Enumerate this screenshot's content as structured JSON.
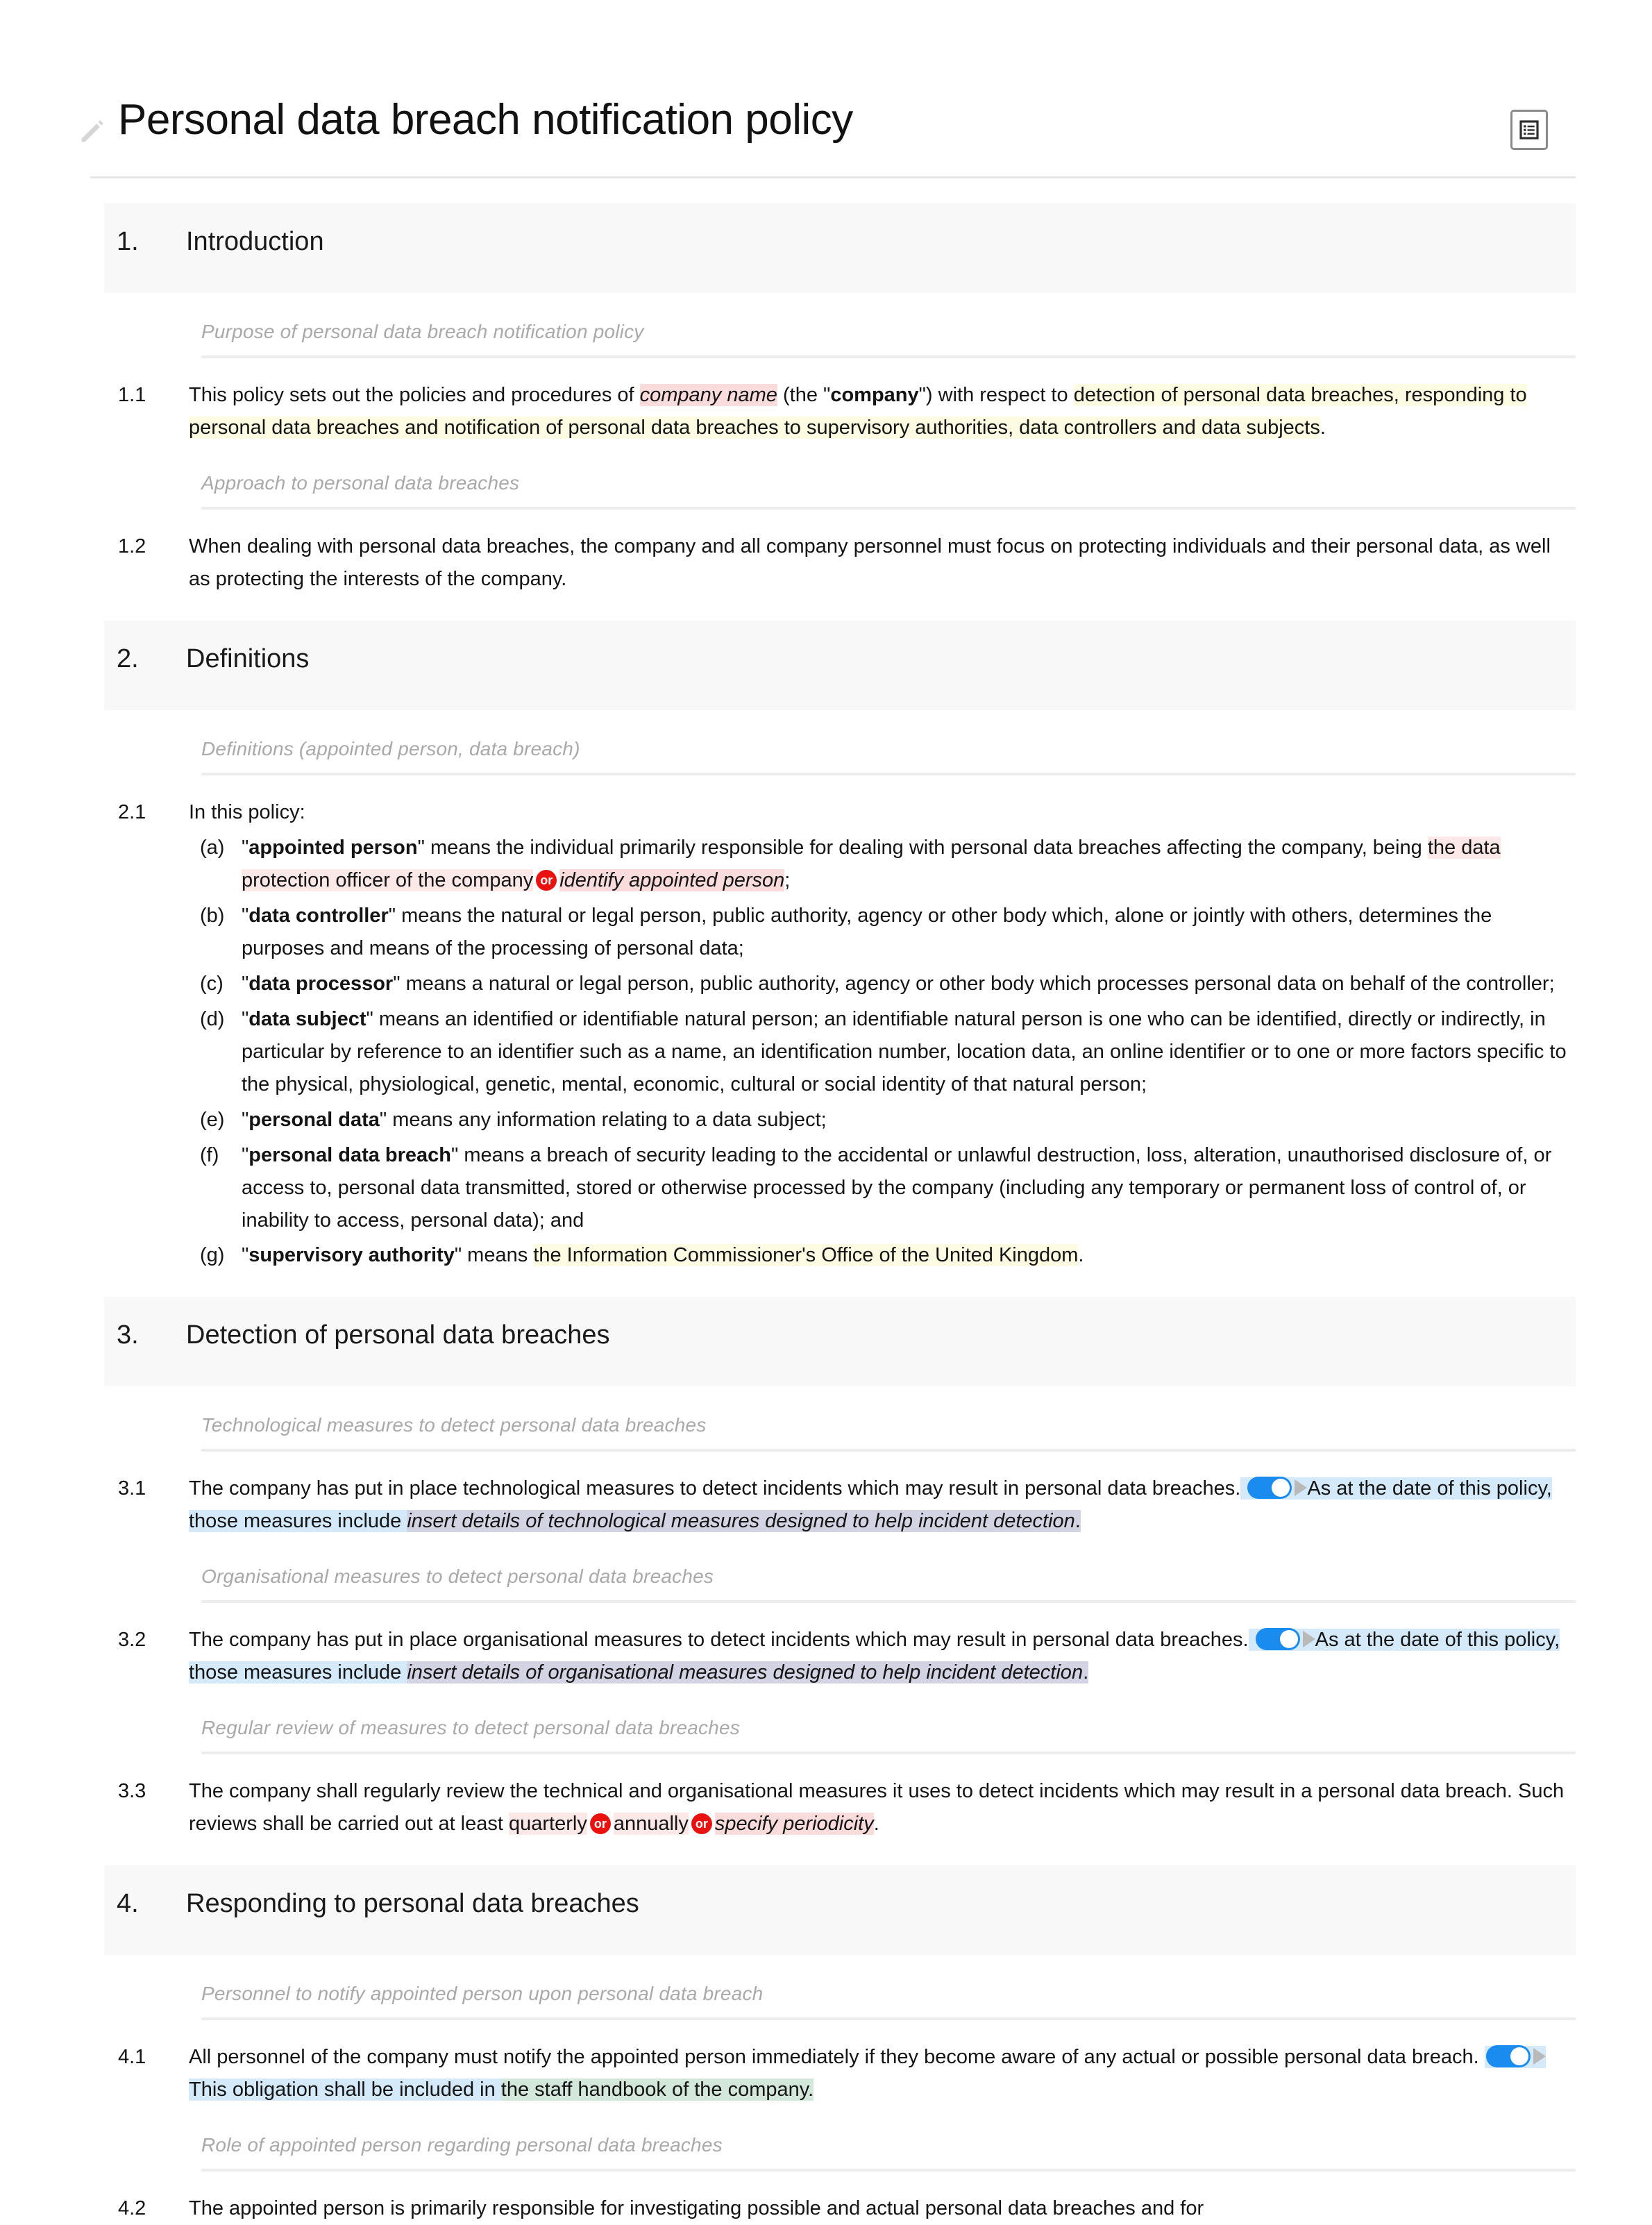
{
  "document": {
    "title": "Personal data breach notification policy",
    "edit_icon": "pencil-icon",
    "toolbar_icon": "document-outline-icon"
  },
  "sections": [
    {
      "number": "1.",
      "title": "Introduction"
    },
    {
      "number": "2.",
      "title": "Definitions"
    },
    {
      "number": "3.",
      "title": "Detection of personal data breaches"
    },
    {
      "number": "4.",
      "title": "Responding to personal data breaches"
    }
  ],
  "guidance": {
    "g1": "Purpose of personal data breach notification policy",
    "g2": "Approach to personal data breaches",
    "g3": "Definitions (appointed person, data breach)",
    "g4": "Technological measures to detect personal data breaches",
    "g5": "Organisational measures to detect personal data breaches",
    "g6": "Regular review of measures to detect personal data breaches",
    "g7": "Personnel to notify appointed person upon personal data breach",
    "g8": "Role of appointed person regarding personal data breaches"
  },
  "clauses": {
    "c11": {
      "num": "1.1",
      "t1": "This policy sets out the policies and procedures of ",
      "var1": "company name",
      "t2": " (the \"",
      "bold1": "company",
      "t3": "\") with respect to ",
      "hl1": "detection of personal data breaches, responding to personal data breaches and notification of personal data breaches to supervisory authorities, data controllers and data subjects",
      "t4": "."
    },
    "c12": {
      "num": "1.2",
      "text": "When dealing with personal data breaches, the company and all company personnel must focus on protecting individuals and their personal data, as well as protecting the interests of the company."
    },
    "c21": {
      "num": "2.1",
      "lead": "In this policy:",
      "items": [
        {
          "label": "(a)",
          "q1": "\"",
          "term": "appointed person",
          "q2": "\" means the individual primarily responsible for dealing with personal data breaches affecting the company, being ",
          "opt1": "the data protection officer of the company",
          "or": "or",
          "opt2": "identify appointed person",
          "tail": ";"
        },
        {
          "label": "(b)",
          "q1": "\"",
          "term": "data controller",
          "q2": "\" means the natural or legal person, public authority, agency or other body which, alone or jointly with others, determines the purposes and means of the processing of personal data;"
        },
        {
          "label": "(c)",
          "q1": "\"",
          "term": "data processor",
          "q2": "\" means a natural or legal person, public authority, agency or other body which processes personal data on behalf of the controller;"
        },
        {
          "label": "(d)",
          "q1": "\"",
          "term": "data subject",
          "q2": "\" means an identified or identifiable natural person; an identifiable natural person is one who can be identified, directly or indirectly, in particular by reference to an identifier such as a name, an identification number, location data, an online identifier or to one or more factors specific to the physical, physiological, genetic, mental, economic, cultural or social identity of that natural person;"
        },
        {
          "label": "(e)",
          "q1": "\"",
          "term": "personal data",
          "q2": "\" means any information relating to a data subject;"
        },
        {
          "label": "(f)",
          "q1": "\"",
          "term": "personal data breach",
          "q2": "\" means a breach of security leading to the accidental or unlawful destruction, loss, alteration, unauthorised disclosure of, or access to, personal data transmitted, stored or otherwise processed by the company (including any temporary or permanent loss of control of, or inability to access, personal data); and"
        },
        {
          "label": "(g)",
          "q1": "\"",
          "term": "supervisory authority",
          "q2": "\" means ",
          "hl": "the Information Commissioner's Office of the United Kingdom",
          "tail": "."
        }
      ]
    },
    "c31": {
      "num": "3.1",
      "t1": "The company has put in place technological measures to detect incidents which may result in personal data breaches.",
      "toggle_state": "on",
      "hl1": "As at the date of this policy, those measures include ",
      "var1": "insert details of technological measures designed to help incident detection",
      "tail": "."
    },
    "c32": {
      "num": "3.2",
      "t1": "The company has put in place organisational measures to detect incidents which may result in personal data breaches.",
      "toggle_state": "on",
      "hl1": "As at the date of this policy, those measures include ",
      "var1": "insert details of organisational measures designed to help incident detection",
      "tail": "."
    },
    "c33": {
      "num": "3.3",
      "t1": "The company shall regularly review the technical and organisational measures it uses to detect incidents which may result in a personal data breach. Such reviews shall be carried out at least ",
      "opt1": "quarterly",
      "or1": "or",
      "opt2": "annually",
      "or2": "or",
      "opt3": "specify periodicity",
      "tail": "."
    },
    "c41": {
      "num": "4.1",
      "t1": "All personnel of the company must notify the appointed person immediately if they become aware of any actual or possible personal data breach. ",
      "toggle_state": "on",
      "t2": " This obligation shall be included in ",
      "hl_green": "the staff handbook of the company.",
      "tail": ""
    },
    "c42": {
      "num": "4.2",
      "text": "The appointed person is primarily responsible for investigating possible and actual personal data breaches and for"
    }
  }
}
